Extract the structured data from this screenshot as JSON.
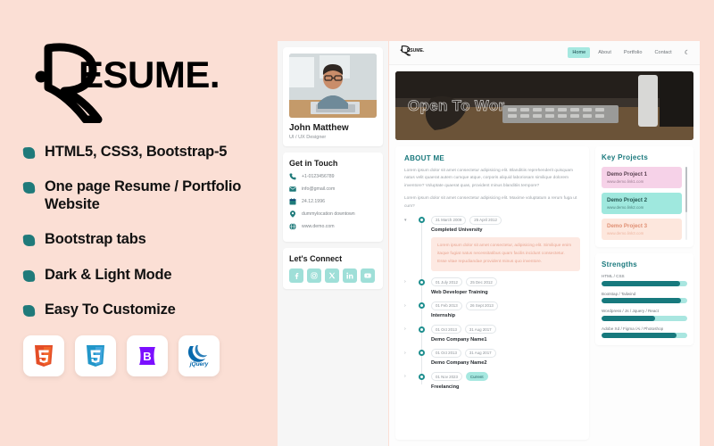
{
  "promo": {
    "logo_text": "RESUME.",
    "features": [
      "HTML5, CSS3, Bootstrap-5",
      "One page Resume / Portfolio Website",
      "Bootstrap tabs",
      "Dark & Light Mode",
      "Easy To Customize"
    ],
    "tech_badges": [
      {
        "name": "html5-icon",
        "label": "HTML5"
      },
      {
        "name": "css3-icon",
        "label": "CSS3"
      },
      {
        "name": "bootstrap-icon",
        "label": "Bootstrap"
      },
      {
        "name": "jquery-icon",
        "label": "jQuery"
      }
    ],
    "background_color": "#fbdfd5",
    "accent_color": "#1f7a7a"
  },
  "sidebar": {
    "avatar_alt": "profile-photo",
    "name": "John Matthew",
    "role": "UI / UX Designer",
    "contact_title": "Get in Touch",
    "contacts": [
      {
        "icon": "phone-icon",
        "text": "+1-0123456789"
      },
      {
        "icon": "mail-icon",
        "text": "info@gmail.com"
      },
      {
        "icon": "calendar-icon",
        "text": "24.12.1996"
      },
      {
        "icon": "location-icon",
        "text": "dummylocation downtown"
      },
      {
        "icon": "globe-icon",
        "text": "www.demo.com"
      }
    ],
    "connect_title": "Let's Connect",
    "socials": [
      {
        "icon": "facebook-icon",
        "label": "Facebook"
      },
      {
        "icon": "instagram-icon",
        "label": "Instagram"
      },
      {
        "icon": "x-twitter-icon",
        "label": "X"
      },
      {
        "icon": "linkedin-icon",
        "label": "LinkedIn"
      },
      {
        "icon": "youtube-icon",
        "label": "YouTube"
      }
    ]
  },
  "site": {
    "navbar": {
      "logo_text": "RESUME.",
      "links": [
        {
          "label": "Home",
          "active": true
        },
        {
          "label": "About",
          "active": false
        },
        {
          "label": "Portfolio",
          "active": false
        },
        {
          "label": "Contact",
          "active": false
        }
      ],
      "theme_toggle": "moon-icon"
    },
    "hero": {
      "title": "Open To Wor"
    },
    "about": {
      "title": "ABOUT ME",
      "paragraphs": [
        "Lorem ipsum dolor sit amet consectetur adipisicing elit. Blanditiis reprehenderit quisquam natus velit quaerat autem cumque atque, corporis aliquid laboriosam similique dolorem inventore? Voluptate quaerat quas, provident minus blanditiis tempore?",
        "Lorem ipsum dolor sit amet consectetur adipisicing elit. Maxime voluptatum a rerum fuga ut cum?"
      ]
    },
    "timeline": [
      {
        "start": "31 March 2009",
        "end": "25 April 2012",
        "current": false,
        "heading": "Completed University",
        "expanded": true,
        "body": "Lorem ipsum dolor sit amet consectetur, adipisicing elit. Similique enim itaque fugiat natus necessitatibus quam facilis incidunt consectetur. Esse vitae repudiandae provident minus quo inventore."
      },
      {
        "start": "01 July 2012",
        "end": "25 Dec 2012",
        "current": false,
        "heading": "Web Developer Training",
        "expanded": false,
        "body": ""
      },
      {
        "start": "01 Feb 2013",
        "end": "26 Sept 2013",
        "current": false,
        "heading": "Internship",
        "expanded": false,
        "body": ""
      },
      {
        "start": "01 Oct 2013",
        "end": "31 Aug 2017",
        "current": false,
        "heading": "Demo Company Name1",
        "expanded": false,
        "body": ""
      },
      {
        "start": "01 Oct 2013",
        "end": "31 Aug 2017",
        "current": false,
        "heading": "Demo Company Name2",
        "expanded": false,
        "body": ""
      },
      {
        "start": "01 Nov 2023",
        "end": "Current",
        "current": true,
        "heading": "Freelancing",
        "expanded": false,
        "body": ""
      }
    ],
    "projects": {
      "title": "Key Projects",
      "items": [
        {
          "name": "Demo Project 1",
          "link": "www.demo.link1.com",
          "bg": "#f6d2e8",
          "fg": "#5b4352"
        },
        {
          "name": "Demo Project 2",
          "link": "www.demo.link2.com",
          "bg": "#9fe8de",
          "fg": "#23544f"
        },
        {
          "name": "Demo Project 3",
          "link": "www.demo.link3.com",
          "bg": "#fde7dd",
          "fg": "#e09074"
        }
      ]
    },
    "strengths": {
      "title": "Strengths",
      "skills": [
        {
          "label": "HTML / CSS",
          "value": 92
        },
        {
          "label": "Bootstap / Tailwind",
          "value": 93
        },
        {
          "label": "Wordpress / Js / Jquery / React",
          "value": 62
        },
        {
          "label": "Adobe Xd / Figma /Ai / Photoshop",
          "value": 88
        }
      ]
    }
  }
}
